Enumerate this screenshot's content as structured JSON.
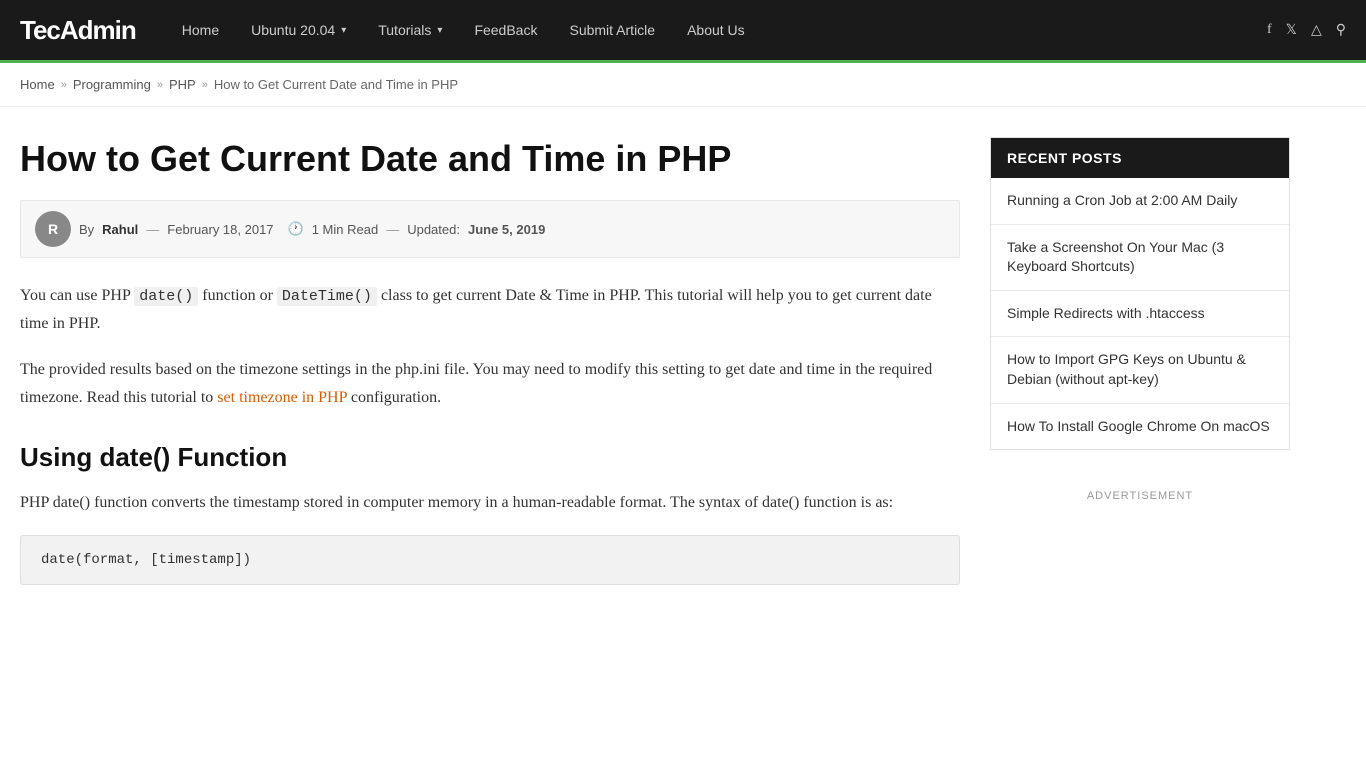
{
  "header": {
    "logo": "TecAdmin",
    "nav": [
      {
        "label": "Home",
        "has_dropdown": false,
        "id": "home"
      },
      {
        "label": "Ubuntu 20.04",
        "has_dropdown": true,
        "id": "ubuntu"
      },
      {
        "label": "Tutorials",
        "has_dropdown": true,
        "id": "tutorials"
      },
      {
        "label": "FeedBack",
        "has_dropdown": false,
        "id": "feedback"
      },
      {
        "label": "Submit Article",
        "has_dropdown": false,
        "id": "submit"
      },
      {
        "label": "About Us",
        "has_dropdown": false,
        "id": "about"
      }
    ],
    "icons": [
      "f",
      "𝕏",
      "📷",
      "🔍"
    ]
  },
  "breadcrumb": {
    "items": [
      "Home",
      "Programming",
      "PHP",
      "How to Get Current Date and Time in PHP"
    ]
  },
  "article": {
    "title": "How to Get Current Date and Time in PHP",
    "meta": {
      "author": "Rahul",
      "date": "February 18, 2017",
      "read_time": "1 Min Read",
      "updated_label": "Updated:",
      "updated_date": "June 5, 2019"
    },
    "intro1": "You can use PHP date() function or DateTime() class to get current Date & Time in PHP. This tutorial will help you to get current date time in PHP.",
    "intro2_before": "The provided results based on the timezone settings in the php.ini file. You may need to modify this setting to get date and time in the required timezone. Read this tutorial to ",
    "intro2_link": "set timezone in PHP",
    "intro2_after": " configuration.",
    "section1_title": "Using date() Function",
    "section1_p1": "PHP date() function converts the timestamp stored in computer memory in a human-readable format. The syntax of date() function is as:",
    "code1": "date(format, [timestamp])"
  },
  "sidebar": {
    "recent_posts_header": "RECENT POSTS",
    "posts": [
      {
        "title": "Running a Cron Job at 2:00 AM Daily"
      },
      {
        "title": "Take a Screenshot On Your Mac (3 Keyboard Shortcuts)"
      },
      {
        "title": "Simple Redirects with .htaccess"
      },
      {
        "title": "How to Import GPG Keys on Ubuntu & Debian (without apt-key)"
      },
      {
        "title": "How To Install Google Chrome On macOS"
      }
    ],
    "ad_label": "ADVERTISEMENT"
  }
}
